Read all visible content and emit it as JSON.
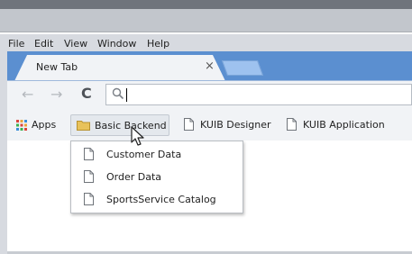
{
  "menubar": {
    "items": [
      "File",
      "Edit",
      "View",
      "Window",
      "Help"
    ]
  },
  "tab": {
    "title": "New Tab",
    "close": "×"
  },
  "nav": {
    "back": "←",
    "forward": "→",
    "reload": "C"
  },
  "omnibox": {
    "value": ""
  },
  "bookmarks": {
    "apps": "Apps",
    "items": [
      {
        "label": "Basic Backend",
        "icon": "folder-icon"
      },
      {
        "label": "KUIB Designer",
        "icon": "page-icon"
      },
      {
        "label": "KUIB Application",
        "icon": "page-icon"
      }
    ]
  },
  "dropdown": {
    "items": [
      "Customer Data",
      "Order Data",
      "SportsService Catalog"
    ]
  },
  "colors": {
    "chrome_blue": "#5b8fd0",
    "toolbar_bg": "#f1f3f6",
    "folder_yellow": "#e8c25a"
  }
}
